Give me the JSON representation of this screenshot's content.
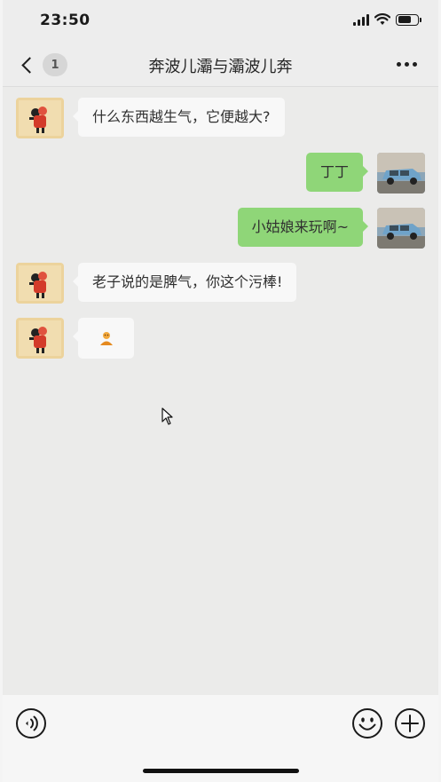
{
  "status_bar": {
    "time": "23:50",
    "battery_level": 0.7,
    "signal_bars": 4
  },
  "nav": {
    "back_icon": "chevron-left-icon",
    "unread_count": "1",
    "title": "奔波儿灞与灞波儿奔",
    "more_icon": "ellipsis-icon"
  },
  "messages": [
    {
      "side": "left",
      "sender": "robot-avatar",
      "text": "什么东西越生气，它便越大?"
    },
    {
      "side": "right",
      "sender": "car-avatar",
      "text": "丁丁"
    },
    {
      "side": "right",
      "sender": "car-avatar",
      "text": "小姑娘来玩啊~"
    },
    {
      "side": "left",
      "sender": "robot-avatar",
      "text": "老子说的是脾气，你这个污棒!"
    },
    {
      "side": "left",
      "sender": "robot-avatar",
      "type": "emoji",
      "emoji": "person-emoji"
    }
  ],
  "input_bar": {
    "voice_icon": "voice-icon",
    "placeholder": "",
    "emoji_icon": "smiley-icon",
    "plus_icon": "plus-icon"
  },
  "colors": {
    "background": "#ebebea",
    "incoming_bubble": "#f8f8f8",
    "outgoing_bubble": "#8fd678",
    "nav_bar": "#ededed"
  }
}
